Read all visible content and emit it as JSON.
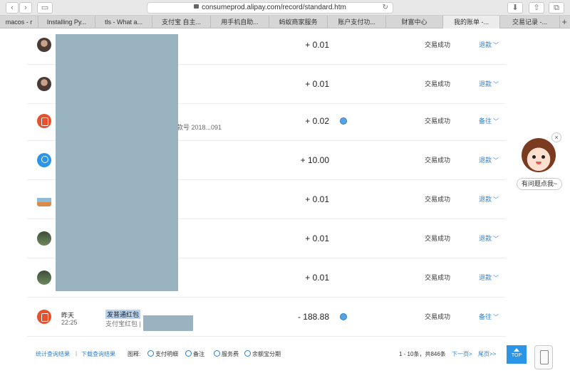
{
  "browser": {
    "url": "consumeprod.alipay.com/record/standard.htm",
    "tabs": [
      "macos - r",
      "Installing Py...",
      "tls - What a...",
      "支付宝 自主...",
      "用手机自助...",
      "蚂蚁商家服务",
      "账户支付功...",
      "财富中心",
      "我的账单 -...",
      "交易记录 -..."
    ]
  },
  "rows": [
    {
      "amount": "+ 0.01",
      "status": "交易成功",
      "action": "退款"
    },
    {
      "amount": "+ 0.01",
      "status": "交易成功",
      "action": "退款"
    },
    {
      "amount": "+ 0.02",
      "status": "交易成功",
      "action": "备往",
      "extra": "款号 2018...091"
    },
    {
      "amount": "+ 10.00",
      "status": "交易成功",
      "action": "退款"
    },
    {
      "amount": "+ 0.01",
      "status": "交易成功",
      "action": "退款"
    },
    {
      "amount": "+ 0.01",
      "status": "交易成功",
      "action": "退款"
    },
    {
      "amount": "+ 0.01",
      "status": "交易成功",
      "action": "退款"
    },
    {
      "amount": "- 188.88",
      "status": "交易成功",
      "action": "备往",
      "day": "昨天",
      "time": "22:25",
      "name": "发普通红包",
      "sub": "支付宝红包 |"
    }
  ],
  "footer": {
    "link_stats": "统计查询结果",
    "separator": "|",
    "link_download": "下载查询结果",
    "legend_label": "图释:",
    "legend_items": [
      "支付明细",
      "备注",
      "服务费",
      "余额宝分期"
    ],
    "pagination": "1 - 10条，共846条",
    "next": "下一页>",
    "last": "尾页>>",
    "top": "TOP"
  },
  "help": {
    "label": "有问题点我~",
    "close": "×"
  }
}
